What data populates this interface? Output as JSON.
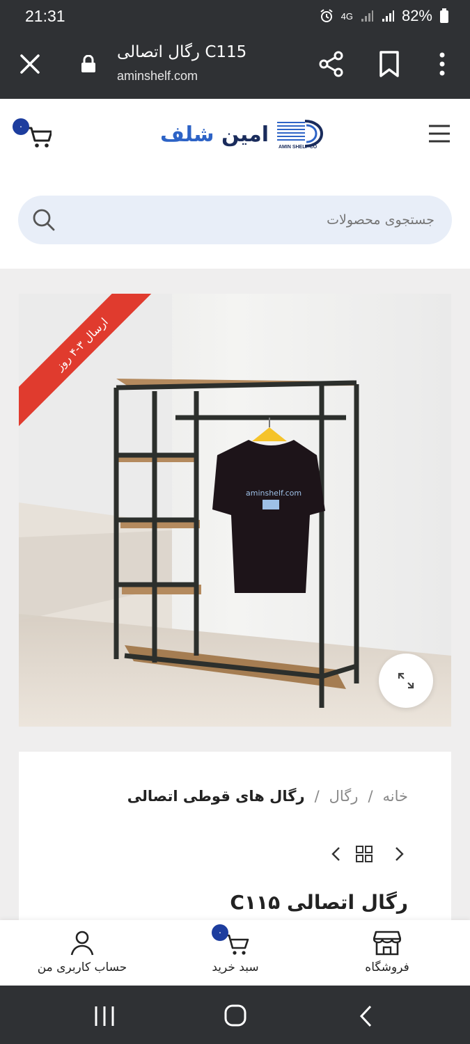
{
  "status_bar": {
    "time": "21:31",
    "battery": "82%",
    "network": "4G"
  },
  "browser": {
    "title": "رگال اتصالی C115",
    "url": "aminshelf.com"
  },
  "header": {
    "logo_text_1": "امین",
    "logo_text_2": "شلف",
    "logo_sub": "AMIN SHELF CO",
    "cart_count": "۰"
  },
  "search": {
    "placeholder": "جستجوی محصولات"
  },
  "product": {
    "ribbon": "ارسال ۳-۴ روز",
    "tshirt_print": "aminshelf.com",
    "title": "رگال اتصالی C۱۱۵"
  },
  "breadcrumb": {
    "home": "خانه",
    "sep": "/",
    "category": "رگال",
    "current": "رگال های قوطی اتصالی"
  },
  "bottom_nav": {
    "shop_label": "فروشگاه",
    "cart_label": "سبد خرید",
    "account_label": "حساب کاربری من",
    "cart_count": "۰"
  },
  "colors": {
    "accent": "#1d3d9e",
    "ribbon": "#e03b2e",
    "dark_bar": "#2f3134",
    "search_bg": "#e8eef8"
  }
}
